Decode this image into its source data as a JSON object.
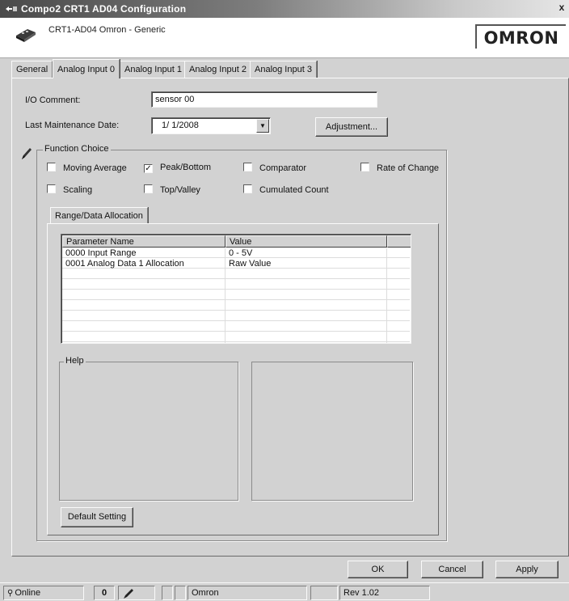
{
  "window": {
    "title": "Compo2  CRT1  AD04   Configuration",
    "close_glyph": "x"
  },
  "header": {
    "device_name": "CRT1-AD04  Omron - Generic",
    "logo_text": "OMRON"
  },
  "tabs": [
    {
      "label": "General"
    },
    {
      "label": "Analog Input 0"
    },
    {
      "label": "Analog Input 1"
    },
    {
      "label": "Analog Input 2"
    },
    {
      "label": "Analog Input 3"
    }
  ],
  "form": {
    "io_comment_label": "I/O Comment:",
    "io_comment_value": "sensor 00",
    "maintenance_label": "Last Maintenance Date:",
    "maintenance_value": "1/  1/2008",
    "adjustment_label": "Adjustment..."
  },
  "function_choice": {
    "title": "Function Choice",
    "options": [
      {
        "label": "Moving Average",
        "checked": false,
        "mark": ""
      },
      {
        "label": "Peak/Bottom",
        "checked": true,
        "mark": "✓"
      },
      {
        "label": "Comparator",
        "checked": false,
        "mark": ""
      },
      {
        "label": "Rate of Change",
        "checked": false,
        "mark": ""
      },
      {
        "label": "Scaling",
        "checked": false,
        "mark": ""
      },
      {
        "label": "Top/Valley",
        "checked": false,
        "mark": ""
      },
      {
        "label": "Cumulated Count",
        "checked": false,
        "mark": ""
      }
    ]
  },
  "range_tab": {
    "label": "Range/Data Allocation",
    "columns": [
      "Parameter Name",
      "Value"
    ],
    "rows": [
      {
        "name": "0000 Input Range",
        "value": "0 - 5V"
      },
      {
        "name": "0001 Analog Data 1 Allocation",
        "value": "Raw Value"
      }
    ],
    "help_label": "Help",
    "default_setting_label": "Default Setting"
  },
  "footer": {
    "ok_label": "OK",
    "cancel_label": "Cancel",
    "apply_label": "Apply"
  },
  "status": {
    "online": "Online",
    "vendor": "Omron",
    "revision": "Rev 1.02"
  }
}
